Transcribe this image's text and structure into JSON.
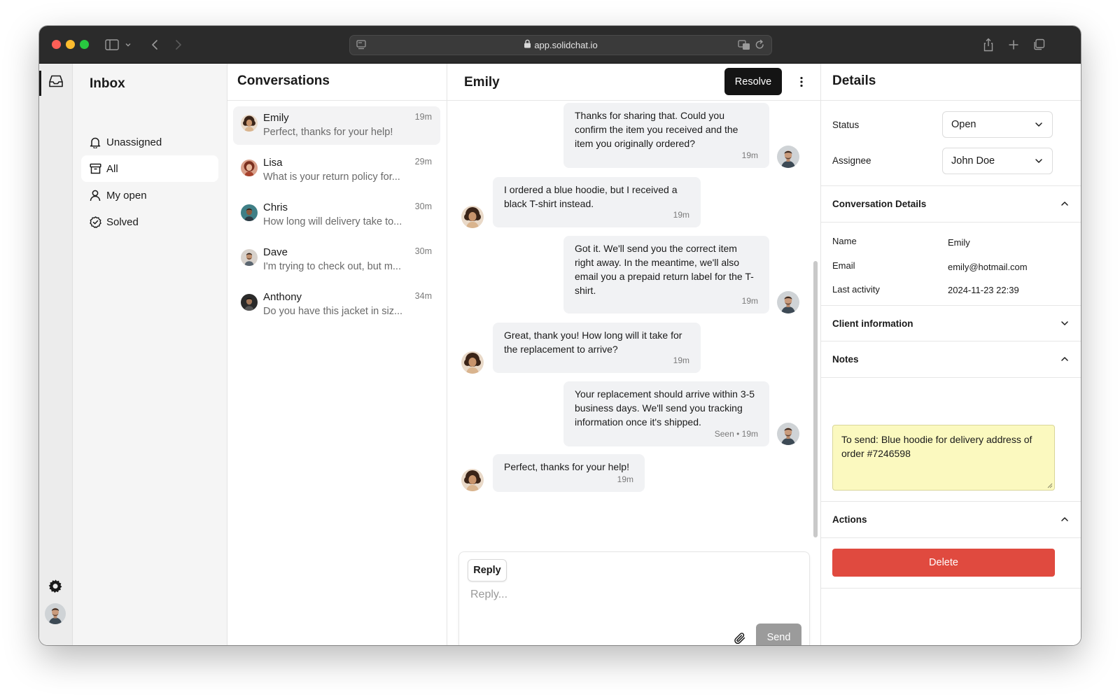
{
  "browser": {
    "url": "app.solidchat.io"
  },
  "inbox": {
    "title": "Inbox",
    "nav": [
      {
        "label": "Unassigned",
        "icon": "bell-icon"
      },
      {
        "label": "All",
        "icon": "archive-box-icon"
      },
      {
        "label": "My open",
        "icon": "user-icon"
      },
      {
        "label": "Solved",
        "icon": "check-circle-icon"
      }
    ]
  },
  "conversations": {
    "title": "Conversations",
    "items": [
      {
        "name": "Emily",
        "time": "19m",
        "preview": "Perfect, thanks for your help!"
      },
      {
        "name": "Lisa",
        "time": "29m",
        "preview": "What is your return policy for..."
      },
      {
        "name": "Chris",
        "time": "30m",
        "preview": "How long will delivery take to..."
      },
      {
        "name": "Dave",
        "time": "30m",
        "preview": "I'm trying to check out, but m..."
      },
      {
        "name": "Anthony",
        "time": "34m",
        "preview": "Do you have this jacket in siz..."
      }
    ]
  },
  "chat": {
    "title": "Emily",
    "resolve_label": "Resolve",
    "messages": [
      {
        "from": "agent",
        "text": "Thanks for sharing that. Could you confirm the item you received and the item you originally ordered?",
        "meta": "19m"
      },
      {
        "from": "customer",
        "text": "I ordered a blue hoodie, but I received a black T-shirt instead.",
        "meta": "19m"
      },
      {
        "from": "agent",
        "text": "Got it. We'll send you the correct item right away. In the meantime, we'll also email you a prepaid return label for the T-shirt.",
        "meta": "19m"
      },
      {
        "from": "customer",
        "text": "Great, thank you! How long will it take for the replacement to arrive?",
        "meta": "19m"
      },
      {
        "from": "agent",
        "text": "Your replacement should arrive within 3-5 business days. We'll send you tracking information once it's shipped.",
        "meta": "Seen • 19m"
      },
      {
        "from": "customer",
        "text": "Perfect, thanks for your help!",
        "meta": "19m"
      }
    ],
    "composer": {
      "tab_label": "Reply",
      "placeholder": "Reply...",
      "send_label": "Send"
    }
  },
  "details": {
    "title": "Details",
    "status_label": "Status",
    "status_value": "Open",
    "assignee_label": "Assignee",
    "assignee_value": "John Doe",
    "conversation_details": {
      "title": "Conversation Details",
      "fields": [
        {
          "label": "Name",
          "value": "Emily"
        },
        {
          "label": "Email",
          "value": "emily@hotmail.com"
        },
        {
          "label": "Last activity",
          "value": "2024-11-23 22:39"
        }
      ]
    },
    "client_information_title": "Client information",
    "notes_title": "Notes",
    "notes_text": "To send: Blue hoodie for delivery address of order #7246598",
    "actions_title": "Actions",
    "delete_label": "Delete"
  },
  "colors": {
    "accent_dark": "#141414",
    "danger": "#e04a3f",
    "notes_bg": "#fbf9bf",
    "bubble_bg": "#f1f2f4"
  }
}
